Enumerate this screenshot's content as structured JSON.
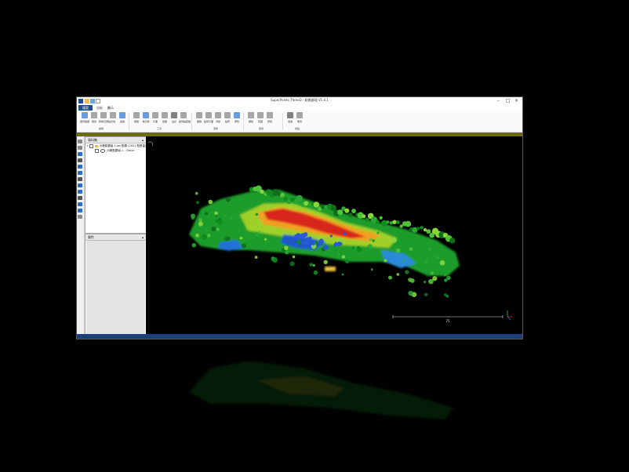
{
  "app": {
    "title": "SuperPoints ThreeD - 點雲處理 V1.0.1"
  },
  "tabs": [
    {
      "label": "檔案"
    },
    {
      "label": "分析"
    },
    {
      "label": "顯示"
    }
  ],
  "ribbon": {
    "groups": [
      {
        "label": "編輯"
      },
      {
        "label": "工具"
      },
      {
        "label": "測量"
      },
      {
        "label": "檢視"
      },
      {
        "label": "視點"
      }
    ],
    "buttons": [
      {
        "label": "邊界範圍",
        "icon": "bounds-icon",
        "color": "#3a7bd5"
      },
      {
        "label": "裁剪",
        "icon": "crop-icon",
        "color": "#8a8a8a"
      },
      {
        "label": "移除近鄰點",
        "icon": "neighbor-icon",
        "color": "#8a8a8a"
      },
      {
        "label": "合併",
        "icon": "merge-icon",
        "color": "#8a8a8a"
      },
      {
        "label": "濾波",
        "icon": "filter-icon",
        "color": "#3a7bd5"
      },
      {
        "label": "體積",
        "icon": "volume-icon",
        "color": "#8a8a8a"
      },
      {
        "label": "等高線",
        "icon": "contour-icon",
        "color": "#3a7bd5"
      },
      {
        "label": "平面",
        "icon": "plane-icon",
        "color": "#8a8a8a"
      },
      {
        "label": "剖面",
        "icon": "section-icon",
        "color": "#8a8a8a"
      },
      {
        "label": "註記",
        "icon": "annotation-icon",
        "color": "#555555"
      },
      {
        "label": "點到點距離",
        "icon": "distance-icon",
        "color": "#8a8a8a"
      },
      {
        "label": "面積",
        "icon": "area-icon",
        "color": "#8a8a8a"
      },
      {
        "label": "點到平面",
        "icon": "point-plane-icon",
        "color": "#8a8a8a"
      },
      {
        "label": "清除",
        "icon": "clear-icon",
        "color": "#8a8a8a"
      },
      {
        "label": "點雲",
        "icon": "cloud-icon",
        "color": "#8a8a8a"
      },
      {
        "label": "著色",
        "icon": "colorize-icon",
        "color": "#3a7bd5"
      },
      {
        "label": "網格",
        "icon": "grid-icon",
        "color": "#8a8a8a"
      },
      {
        "label": "隱藏",
        "icon": "hide-icon",
        "color": "#8a8a8a"
      },
      {
        "label": "俯視",
        "icon": "top-view-icon",
        "color": "#8a8a8a"
      },
      {
        "label": "過濾",
        "icon": "funnel-icon",
        "color": "#555555"
      },
      {
        "label": "重置",
        "icon": "reset-icon",
        "color": "#8a8a8a"
      }
    ]
  },
  "db_tree": {
    "title": "資料集",
    "items": [
      {
        "label": "示範點雲組-1.las 點雲 (2021 點數量)"
      },
      {
        "label": "示範點雲組-1 - Cloud"
      }
    ]
  },
  "properties": {
    "title": "屬性"
  },
  "viewport": {
    "scale_label": "75"
  },
  "colors": {
    "accent": "#1f4e8c",
    "toolbar_band": "#6b6b14",
    "statusbar": "#1b3f78"
  }
}
